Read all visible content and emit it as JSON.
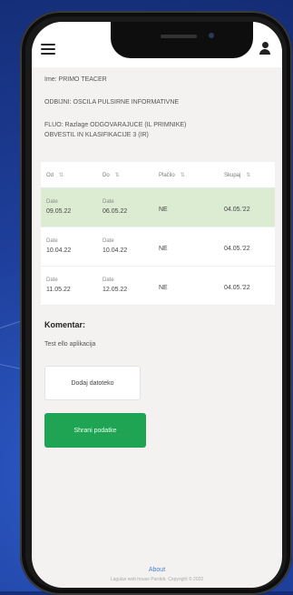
{
  "header": {
    "menu_icon": "hamburger-menu-icon",
    "user_icon": "user-icon"
  },
  "info": {
    "line1": "Ime: PRIMO TEACER",
    "line2": "ODBIJNI: OSCILA PULSIRNE INFORMATIVNE",
    "line3a": "FLUO: Razlage ODGOVARAJUCE (IL PRIMNIKE)",
    "line3b": "OBVESTIL IN KLASIFIKACIJE 3 (IR)"
  },
  "table": {
    "headers": [
      "Od",
      "Do",
      "Plačilo",
      "Skupaj"
    ],
    "rows": [
      {
        "from_label": "Date",
        "from_date": "09.05.22",
        "to_label": "Date",
        "to_date": "06.05.22",
        "pay": "NE",
        "total": "04.05.'22",
        "highlight": true
      },
      {
        "from_label": "Date",
        "from_date": "10.04.22",
        "to_label": "Date",
        "to_date": "10.04.22",
        "pay": "NE",
        "total": "04.05.'22",
        "highlight": false
      },
      {
        "from_label": "Date",
        "from_date": "11.05.22",
        "to_label": "Date",
        "to_date": "12.05.22",
        "pay": "NE",
        "total": "04.05.'22",
        "highlight": false
      }
    ]
  },
  "comment": {
    "title": "Komentar:",
    "text": "Test ello aplikacija"
  },
  "buttons": {
    "outline": "Dodaj datoteko",
    "green": "Shrani podatke"
  },
  "footer": {
    "link": "About",
    "copyright": "Lagulas web house Pardeb. Copyright © 2022"
  },
  "colors": {
    "accent_green": "#1fa454",
    "row_highlight": "#dcecd3",
    "link_blue": "#4a7fd0"
  }
}
